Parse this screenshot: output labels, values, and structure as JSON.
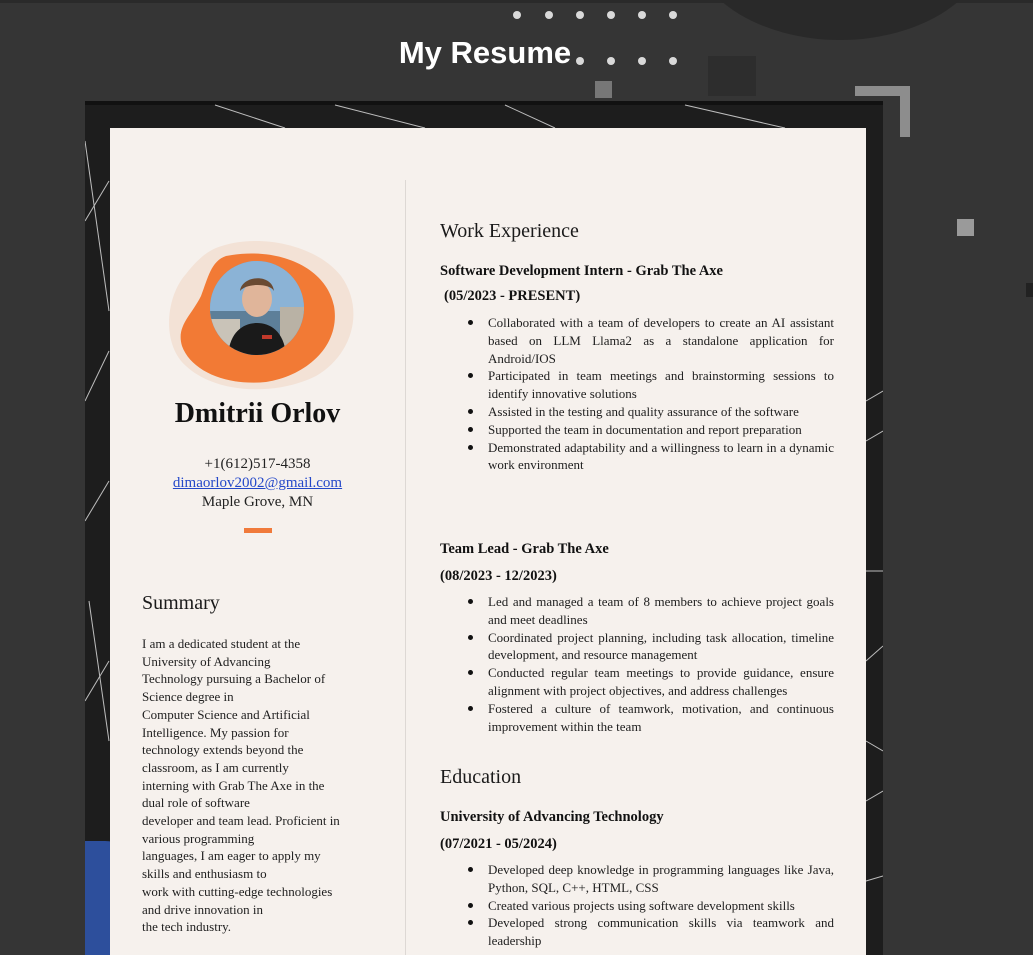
{
  "header": {
    "title": "My Resume"
  },
  "profile": {
    "name": "Dmitrii Orlov",
    "phone": "+1(612)517-4358",
    "email": "dimaorlov2002@gmail.com",
    "location": "Maple Grove, MN"
  },
  "summary": {
    "heading": "Summary",
    "text": "I am a dedicated student at the\nUniversity of Advancing\nTechnology pursuing a Bachelor of\nScience degree in\nComputer Science and Artificial\nIntelligence. My passion for\ntechnology extends beyond the\nclassroom, as I am currently\ninterning with Grab The Axe in the\ndual role of software\ndeveloper and team lead. Proficient in\nvarious programming\nlanguages, I am eager to apply my\nskills and enthusiasm to\nwork with cutting-edge technologies\nand drive innovation in\nthe tech industry."
  },
  "work": {
    "heading": "Work Experience",
    "jobs": [
      {
        "title": "Software Development Intern - Grab The Axe",
        "dates": "(05/2023 - PRESENT)",
        "bullets": [
          "Collaborated with a team of developers to create an AI assistant based on LLM Llama2 as a standalone application for Android/IOS",
          "Participated in team meetings and brainstorming sessions to identify innovative solutions",
          "Assisted in the testing and quality assurance of the software",
          "Supported the team in documentation and report preparation",
          "Demonstrated adaptability and a willingness to learn in a dynamic work environment"
        ]
      },
      {
        "title": "Team Lead - Grab The Axe",
        "dates": "(08/2023 - 12/2023)",
        "bullets": [
          "Led and managed a team of 8 members to achieve project goals and meet deadlines",
          "Coordinated project planning, including task allocation, timeline development, and resource management",
          "Conducted regular team meetings to provide guidance, ensure alignment with project objectives, and address challenges",
          "Fostered a culture of teamwork, motivation, and continuous improvement within the team"
        ]
      }
    ]
  },
  "education": {
    "heading": "Education",
    "school": "University of Advancing Technology",
    "dates": "(07/2021 - 05/2024)",
    "bullets": [
      "Developed deep knowledge in programming languages like Java, Python, SQL, C++, HTML, CSS",
      "Created various projects using software development skills",
      "Developed strong communication skills via teamwork and leadership"
    ]
  },
  "colors": {
    "accent": "#f07a3b",
    "background": "#353535",
    "paper": "#f6f1ed",
    "link": "#2448c9",
    "decor_blue": "#2d4f9c"
  },
  "icons": [
    "avatar-photo",
    "orange-blob-decoration"
  ]
}
